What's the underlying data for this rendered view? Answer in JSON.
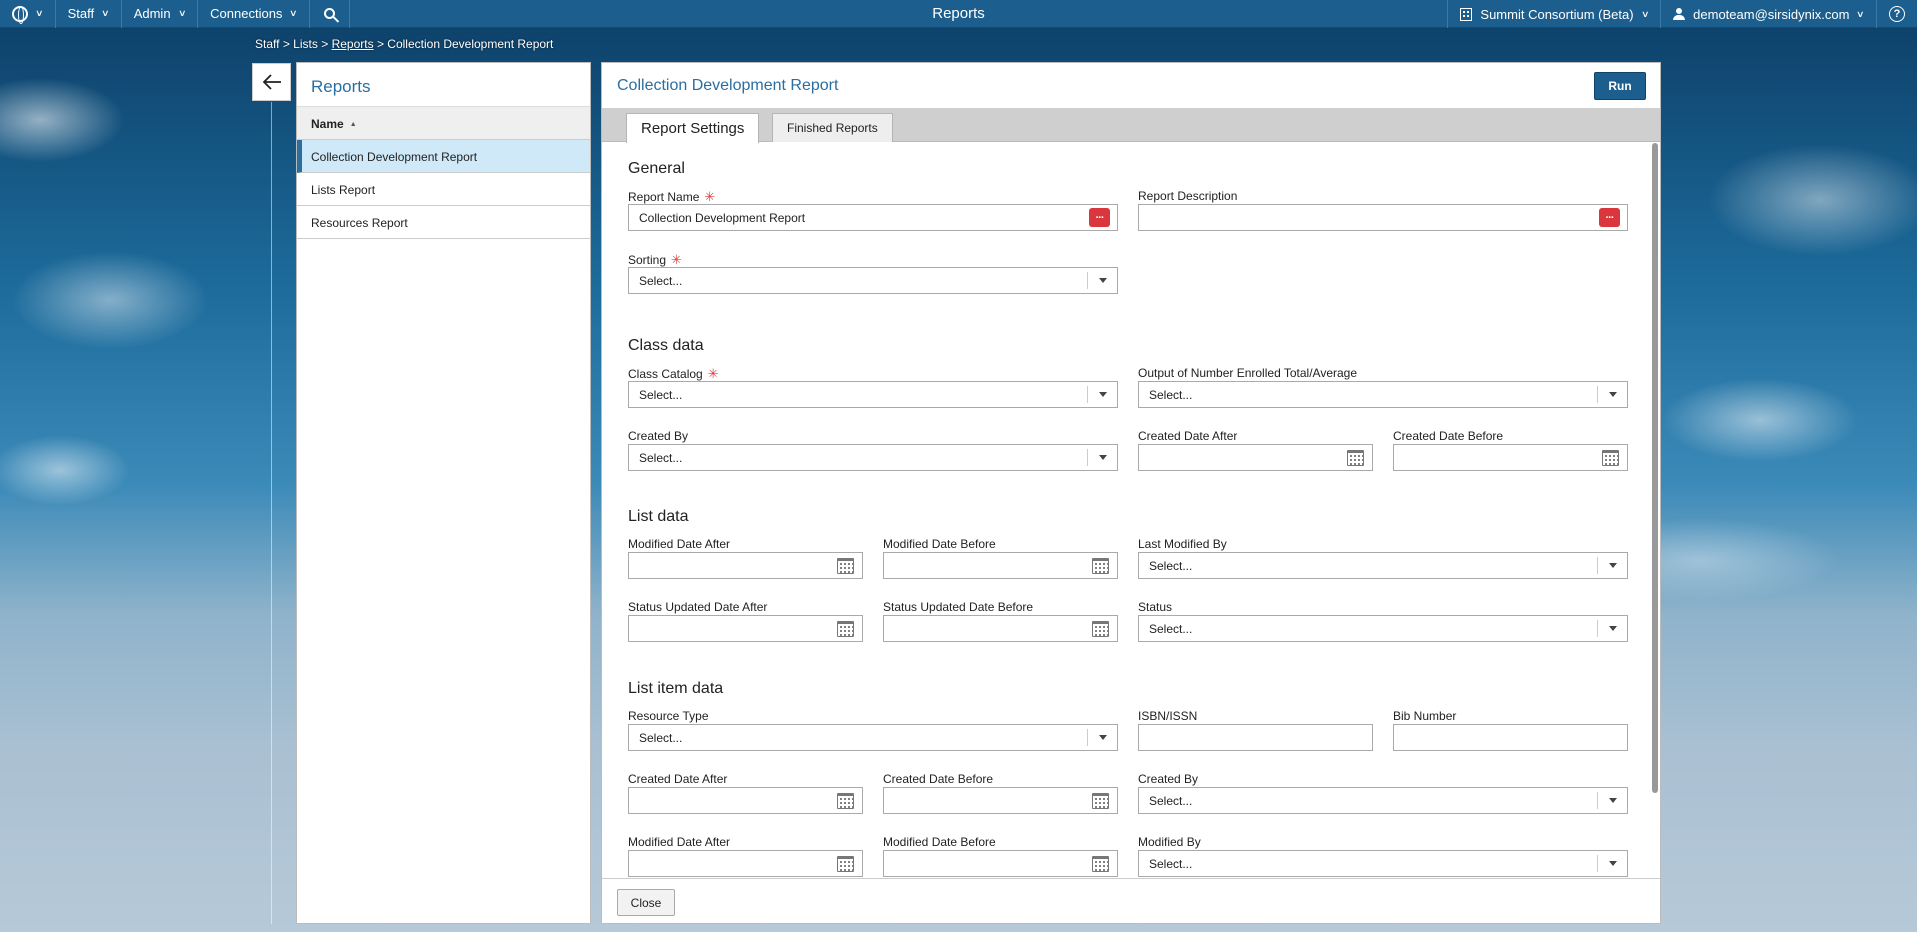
{
  "topbar": {
    "title": "Reports",
    "menus": [
      "Staff",
      "Admin",
      "Connections"
    ],
    "consortium": "Summit Consortium (Beta)",
    "user": "demoteam@sirsidynix.com"
  },
  "breadcrumb": {
    "staff": "Staff",
    "lists": "Lists",
    "reports": "Reports",
    "current": "Collection Development Report",
    "separator": ">"
  },
  "left_panel": {
    "title": "Reports",
    "column_header": "Name",
    "items": [
      "Collection Development Report",
      "Lists Report",
      "Resources Report"
    ]
  },
  "main": {
    "title": "Collection Development Report",
    "run_label": "Run",
    "tabs": [
      "Report Settings",
      "Finished Reports"
    ],
    "close_label": "Close",
    "placeholder": "Select...",
    "sections": {
      "general": {
        "title": "General",
        "report_name_label": "Report Name",
        "report_name_value": "Collection Development Report",
        "report_description_label": "Report Description",
        "sorting_label": "Sorting"
      },
      "class_data": {
        "title": "Class data",
        "class_catalog_label": "Class Catalog",
        "output_label": "Output of Number Enrolled Total/Average",
        "created_by_label": "Created By",
        "created_after_label": "Created Date After",
        "created_before_label": "Created Date Before"
      },
      "list_data": {
        "title": "List data",
        "modified_after_label": "Modified Date After",
        "modified_before_label": "Modified Date Before",
        "last_modified_by_label": "Last Modified By",
        "status_updated_after_label": "Status Updated Date After",
        "status_updated_before_label": "Status Updated Date Before",
        "status_label": "Status"
      },
      "list_item_data": {
        "title": "List item data",
        "resource_type_label": "Resource Type",
        "isbn_label": "ISBN/ISSN",
        "bib_number_label": "Bib Number",
        "created_after_label": "Created Date After",
        "created_before_label": "Created Date Before",
        "created_by_label": "Created By",
        "modified_after_label": "Modified Date After",
        "modified_before_label": "Modified Date Before",
        "modified_by_label": "Modified By"
      }
    }
  },
  "colors": {
    "topbar": "#1c5f8e",
    "accent": "#2a6fa0",
    "required": "#e03a3a",
    "selected_row": "#cfe9f9"
  }
}
